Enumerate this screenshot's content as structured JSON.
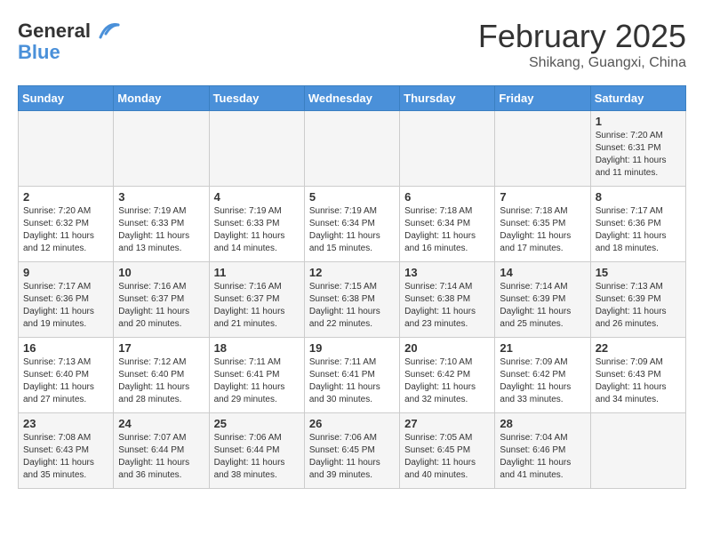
{
  "header": {
    "logo_line1": "General",
    "logo_line2": "Blue",
    "month": "February 2025",
    "location": "Shikang, Guangxi, China"
  },
  "days_of_week": [
    "Sunday",
    "Monday",
    "Tuesday",
    "Wednesday",
    "Thursday",
    "Friday",
    "Saturday"
  ],
  "weeks": [
    {
      "row_shade": "light",
      "days": [
        {
          "num": "",
          "info": ""
        },
        {
          "num": "",
          "info": ""
        },
        {
          "num": "",
          "info": ""
        },
        {
          "num": "",
          "info": ""
        },
        {
          "num": "",
          "info": ""
        },
        {
          "num": "",
          "info": ""
        },
        {
          "num": "1",
          "info": "Sunrise: 7:20 AM\nSunset: 6:31 PM\nDaylight: 11 hours\nand 11 minutes."
        }
      ]
    },
    {
      "row_shade": "dark",
      "days": [
        {
          "num": "2",
          "info": "Sunrise: 7:20 AM\nSunset: 6:32 PM\nDaylight: 11 hours\nand 12 minutes."
        },
        {
          "num": "3",
          "info": "Sunrise: 7:19 AM\nSunset: 6:33 PM\nDaylight: 11 hours\nand 13 minutes."
        },
        {
          "num": "4",
          "info": "Sunrise: 7:19 AM\nSunset: 6:33 PM\nDaylight: 11 hours\nand 14 minutes."
        },
        {
          "num": "5",
          "info": "Sunrise: 7:19 AM\nSunset: 6:34 PM\nDaylight: 11 hours\nand 15 minutes."
        },
        {
          "num": "6",
          "info": "Sunrise: 7:18 AM\nSunset: 6:34 PM\nDaylight: 11 hours\nand 16 minutes."
        },
        {
          "num": "7",
          "info": "Sunrise: 7:18 AM\nSunset: 6:35 PM\nDaylight: 11 hours\nand 17 minutes."
        },
        {
          "num": "8",
          "info": "Sunrise: 7:17 AM\nSunset: 6:36 PM\nDaylight: 11 hours\nand 18 minutes."
        }
      ]
    },
    {
      "row_shade": "light",
      "days": [
        {
          "num": "9",
          "info": "Sunrise: 7:17 AM\nSunset: 6:36 PM\nDaylight: 11 hours\nand 19 minutes."
        },
        {
          "num": "10",
          "info": "Sunrise: 7:16 AM\nSunset: 6:37 PM\nDaylight: 11 hours\nand 20 minutes."
        },
        {
          "num": "11",
          "info": "Sunrise: 7:16 AM\nSunset: 6:37 PM\nDaylight: 11 hours\nand 21 minutes."
        },
        {
          "num": "12",
          "info": "Sunrise: 7:15 AM\nSunset: 6:38 PM\nDaylight: 11 hours\nand 22 minutes."
        },
        {
          "num": "13",
          "info": "Sunrise: 7:14 AM\nSunset: 6:38 PM\nDaylight: 11 hours\nand 23 minutes."
        },
        {
          "num": "14",
          "info": "Sunrise: 7:14 AM\nSunset: 6:39 PM\nDaylight: 11 hours\nand 25 minutes."
        },
        {
          "num": "15",
          "info": "Sunrise: 7:13 AM\nSunset: 6:39 PM\nDaylight: 11 hours\nand 26 minutes."
        }
      ]
    },
    {
      "row_shade": "dark",
      "days": [
        {
          "num": "16",
          "info": "Sunrise: 7:13 AM\nSunset: 6:40 PM\nDaylight: 11 hours\nand 27 minutes."
        },
        {
          "num": "17",
          "info": "Sunrise: 7:12 AM\nSunset: 6:40 PM\nDaylight: 11 hours\nand 28 minutes."
        },
        {
          "num": "18",
          "info": "Sunrise: 7:11 AM\nSunset: 6:41 PM\nDaylight: 11 hours\nand 29 minutes."
        },
        {
          "num": "19",
          "info": "Sunrise: 7:11 AM\nSunset: 6:41 PM\nDaylight: 11 hours\nand 30 minutes."
        },
        {
          "num": "20",
          "info": "Sunrise: 7:10 AM\nSunset: 6:42 PM\nDaylight: 11 hours\nand 32 minutes."
        },
        {
          "num": "21",
          "info": "Sunrise: 7:09 AM\nSunset: 6:42 PM\nDaylight: 11 hours\nand 33 minutes."
        },
        {
          "num": "22",
          "info": "Sunrise: 7:09 AM\nSunset: 6:43 PM\nDaylight: 11 hours\nand 34 minutes."
        }
      ]
    },
    {
      "row_shade": "light",
      "days": [
        {
          "num": "23",
          "info": "Sunrise: 7:08 AM\nSunset: 6:43 PM\nDaylight: 11 hours\nand 35 minutes."
        },
        {
          "num": "24",
          "info": "Sunrise: 7:07 AM\nSunset: 6:44 PM\nDaylight: 11 hours\nand 36 minutes."
        },
        {
          "num": "25",
          "info": "Sunrise: 7:06 AM\nSunset: 6:44 PM\nDaylight: 11 hours\nand 38 minutes."
        },
        {
          "num": "26",
          "info": "Sunrise: 7:06 AM\nSunset: 6:45 PM\nDaylight: 11 hours\nand 39 minutes."
        },
        {
          "num": "27",
          "info": "Sunrise: 7:05 AM\nSunset: 6:45 PM\nDaylight: 11 hours\nand 40 minutes."
        },
        {
          "num": "28",
          "info": "Sunrise: 7:04 AM\nSunset: 6:46 PM\nDaylight: 11 hours\nand 41 minutes."
        },
        {
          "num": "",
          "info": ""
        }
      ]
    }
  ]
}
